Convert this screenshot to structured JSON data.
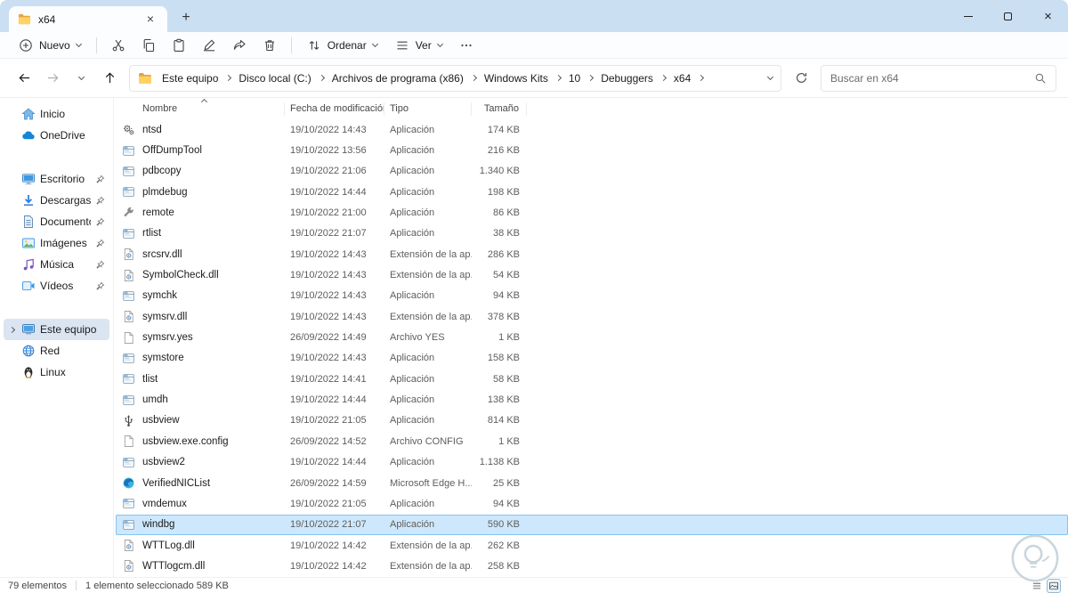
{
  "window": {
    "tab_title": "x64"
  },
  "toolbar": {
    "new_label": "Nuevo",
    "sort_label": "Ordenar",
    "view_label": "Ver"
  },
  "address": {
    "breadcrumbs": [
      "Este equipo",
      "Disco local (C:)",
      "Archivos de programa (x86)",
      "Windows Kits",
      "10",
      "Debuggers",
      "x64"
    ],
    "search_placeholder": "Buscar en x64"
  },
  "sidebar": {
    "sections": [
      {
        "items": [
          {
            "label": "Inicio",
            "icon": "home"
          },
          {
            "label": "OneDrive",
            "icon": "cloud"
          }
        ]
      },
      {
        "items": [
          {
            "label": "Escritorio",
            "icon": "desktop",
            "pinned": true
          },
          {
            "label": "Descargas",
            "icon": "downloads",
            "pinned": true
          },
          {
            "label": "Documentos",
            "icon": "documents",
            "pinned": true
          },
          {
            "label": "Imágenes",
            "icon": "pictures",
            "pinned": true
          },
          {
            "label": "Música",
            "icon": "music",
            "pinned": true
          },
          {
            "label": "Vídeos",
            "icon": "videos",
            "pinned": true
          }
        ]
      },
      {
        "items": [
          {
            "label": "Este equipo",
            "icon": "computer",
            "selected": true,
            "expandable": true
          },
          {
            "label": "Red",
            "icon": "network"
          },
          {
            "label": "Linux",
            "icon": "linux"
          }
        ]
      }
    ]
  },
  "file_list": {
    "columns": [
      "Nombre",
      "Fecha de modificación",
      "Tipo",
      "Tamaño"
    ],
    "rows": [
      {
        "name": "ntsd",
        "date": "19/10/2022 14:43",
        "type": "Aplicación",
        "size": "174 KB",
        "icon": "gear"
      },
      {
        "name": "OffDumpTool",
        "date": "19/10/2022 13:56",
        "type": "Aplicación",
        "size": "216 KB",
        "icon": "app"
      },
      {
        "name": "pdbcopy",
        "date": "19/10/2022 21:06",
        "type": "Aplicación",
        "size": "1.340 KB",
        "icon": "app"
      },
      {
        "name": "plmdebug",
        "date": "19/10/2022 14:44",
        "type": "Aplicación",
        "size": "198 KB",
        "icon": "app"
      },
      {
        "name": "remote",
        "date": "19/10/2022 21:00",
        "type": "Aplicación",
        "size": "86 KB",
        "icon": "tool"
      },
      {
        "name": "rtlist",
        "date": "19/10/2022 21:07",
        "type": "Aplicación",
        "size": "38 KB",
        "icon": "app"
      },
      {
        "name": "srcsrv.dll",
        "date": "19/10/2022 14:43",
        "type": "Extensión de la ap...",
        "size": "286 KB",
        "icon": "dll"
      },
      {
        "name": "SymbolCheck.dll",
        "date": "19/10/2022 14:43",
        "type": "Extensión de la ap...",
        "size": "54 KB",
        "icon": "dll"
      },
      {
        "name": "symchk",
        "date": "19/10/2022 14:43",
        "type": "Aplicación",
        "size": "94 KB",
        "icon": "app"
      },
      {
        "name": "symsrv.dll",
        "date": "19/10/2022 14:43",
        "type": "Extensión de la ap...",
        "size": "378 KB",
        "icon": "dll"
      },
      {
        "name": "symsrv.yes",
        "date": "26/09/2022 14:49",
        "type": "Archivo YES",
        "size": "1 KB",
        "icon": "file"
      },
      {
        "name": "symstore",
        "date": "19/10/2022 14:43",
        "type": "Aplicación",
        "size": "158 KB",
        "icon": "app"
      },
      {
        "name": "tlist",
        "date": "19/10/2022 14:41",
        "type": "Aplicación",
        "size": "58 KB",
        "icon": "app"
      },
      {
        "name": "umdh",
        "date": "19/10/2022 14:44",
        "type": "Aplicación",
        "size": "138 KB",
        "icon": "app"
      },
      {
        "name": "usbview",
        "date": "19/10/2022 21:05",
        "type": "Aplicación",
        "size": "814 KB",
        "icon": "usb"
      },
      {
        "name": "usbview.exe.config",
        "date": "26/09/2022 14:52",
        "type": "Archivo CONFIG",
        "size": "1 KB",
        "icon": "file"
      },
      {
        "name": "usbview2",
        "date": "19/10/2022 14:44",
        "type": "Aplicación",
        "size": "1.138 KB",
        "icon": "app"
      },
      {
        "name": "VerifiedNICList",
        "date": "26/09/2022 14:59",
        "type": "Microsoft Edge H...",
        "size": "25 KB",
        "icon": "edge"
      },
      {
        "name": "vmdemux",
        "date": "19/10/2022 21:05",
        "type": "Aplicación",
        "size": "94 KB",
        "icon": "app"
      },
      {
        "name": "windbg",
        "date": "19/10/2022 21:07",
        "type": "Aplicación",
        "size": "590 KB",
        "icon": "app",
        "selected": true
      },
      {
        "name": "WTTLog.dll",
        "date": "19/10/2022 14:42",
        "type": "Extensión de la ap...",
        "size": "262 KB",
        "icon": "dll"
      },
      {
        "name": "WTTlogcm.dll",
        "date": "19/10/2022 14:42",
        "type": "Extensión de la ap...",
        "size": "258 KB",
        "icon": "dll"
      }
    ]
  },
  "status": {
    "count": "79 elementos",
    "selection": "1 elemento seleccionado 589 KB"
  }
}
